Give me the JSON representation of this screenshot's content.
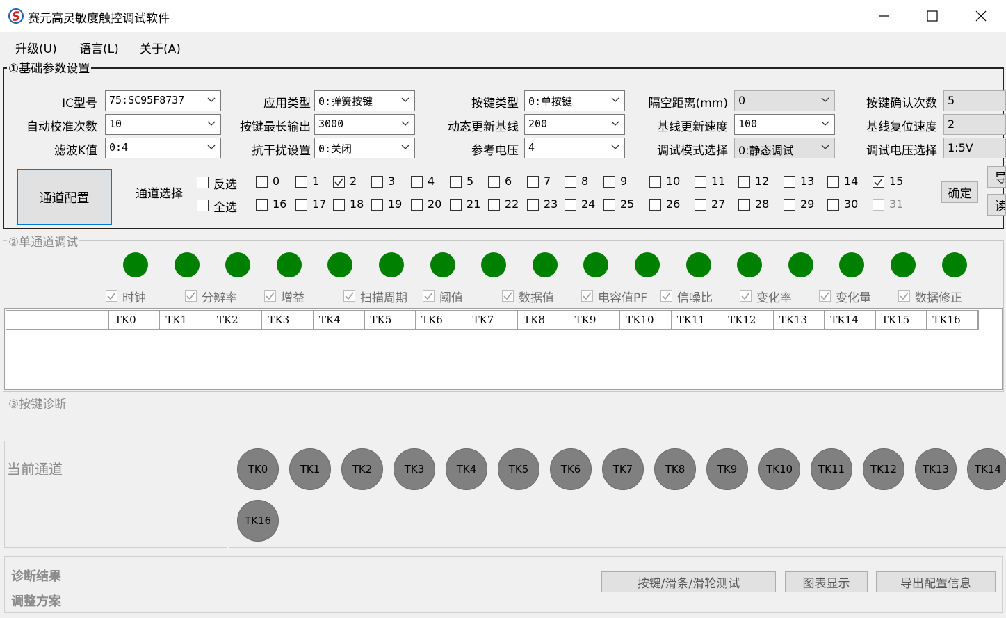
{
  "window": {
    "title": "赛元高灵敏度触控调试软件",
    "minimize_glyph": "—",
    "maximize_glyph": "☐",
    "close_glyph": "✕"
  },
  "menu": [
    "升级(U)",
    "语言(L)",
    "关于(A)"
  ],
  "basic": {
    "title": "①基础参数设置",
    "fields": [
      {
        "label": "IC型号",
        "value": "75:SC95F8737"
      },
      {
        "label": "应用类型",
        "value": "0:弹簧按键"
      },
      {
        "label": "按键类型",
        "value": "0:单按键"
      },
      {
        "label": "隔空距离(mm)",
        "value": "0"
      },
      {
        "label": "按键确认次数",
        "value": "5"
      },
      {
        "label": "自动校准次数",
        "value": "10"
      },
      {
        "label": "按键最长输出",
        "value": "3000"
      },
      {
        "label": "动态更新基线",
        "value": "200"
      },
      {
        "label": "基线更新速度",
        "value": "100"
      },
      {
        "label": "基线复位速度",
        "value": "2"
      },
      {
        "label": "滤波K值",
        "value": "0:4"
      },
      {
        "label": "抗干扰设置",
        "value": "0:关闭"
      },
      {
        "label": "参考电压",
        "value": "4"
      },
      {
        "label": "调试模式选择",
        "value": "0:静态调试"
      },
      {
        "label": "调试电压选择",
        "value": "1:5V"
      }
    ],
    "channel_config_button": "通道配置",
    "channel_select_label": "通道选择",
    "invert_label": "反选",
    "select_all_label": "全选",
    "channels_row1": [
      "0",
      "1",
      "2",
      "3",
      "4",
      "5",
      "6",
      "7",
      "8",
      "9",
      "10",
      "11",
      "12",
      "13",
      "14",
      "15"
    ],
    "channels_row2": [
      "16",
      "17",
      "18",
      "19",
      "20",
      "21",
      "22",
      "23",
      "24",
      "25",
      "26",
      "27",
      "28",
      "29",
      "30",
      "31"
    ],
    "checked": [
      "2",
      "15"
    ],
    "disabled": [
      "31"
    ],
    "confirm_button": "确定",
    "side_btn1": "导",
    "side_btn2": "读"
  },
  "single": {
    "title": "②单通道调试",
    "led_color": "#008000",
    "led_count": 17,
    "options": [
      "时钟",
      "分辨率",
      "增益",
      "扫描周期",
      "阈值",
      "数据值",
      "电容值PF",
      "信噪比",
      "变化率",
      "变化量",
      "数据修正"
    ],
    "grid_headers": [
      "",
      "TK0",
      "TK1",
      "TK2",
      "TK3",
      "TK4",
      "TK5",
      "TK6",
      "TK7",
      "TK8",
      "TK9",
      "TK10",
      "TK11",
      "TK12",
      "TK13",
      "TK14",
      "TK15",
      "TK16"
    ]
  },
  "diag": {
    "title": "③按键诊断",
    "current_channel_label": "当前通道",
    "keys": [
      "TK0",
      "TK1",
      "TK2",
      "TK3",
      "TK4",
      "TK5",
      "TK6",
      "TK7",
      "TK8",
      "TK9",
      "TK10",
      "TK11",
      "TK12",
      "TK13",
      "TK14",
      "TK16"
    ],
    "result_label": "诊断结果",
    "adjust_label": "调整方案",
    "buttons": [
      "按键/滑条/滑轮测试",
      "图表显示",
      "导出配置信息"
    ]
  }
}
